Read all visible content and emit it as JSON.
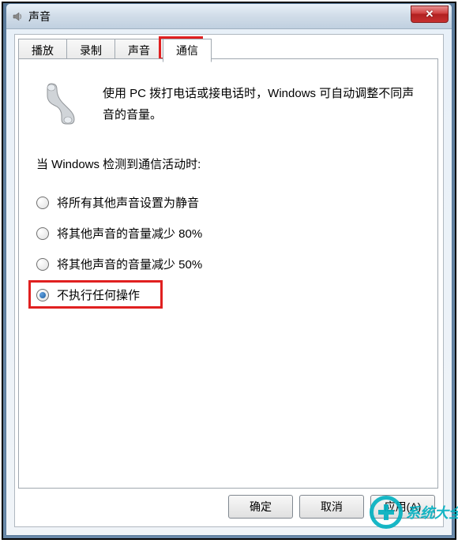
{
  "window": {
    "title": "声音"
  },
  "tabs": {
    "items": [
      {
        "label": "播放"
      },
      {
        "label": "录制"
      },
      {
        "label": "声音"
      },
      {
        "label": "通信"
      }
    ],
    "active_index": 3
  },
  "panel": {
    "intro": "使用 PC 拨打电话或接电话时，Windows 可自动调整不同声音的音量。",
    "section_label": "当 Windows 检测到通信活动时:",
    "options": [
      {
        "label": "将所有其他声音设置为静音",
        "checked": false
      },
      {
        "label": "将其他声音的音量减少 80%",
        "checked": false
      },
      {
        "label": "将其他声音的音量减少 50%",
        "checked": false
      },
      {
        "label": "不执行任何操作",
        "checked": true
      }
    ]
  },
  "buttons": {
    "ok": "确定",
    "cancel": "取消",
    "apply": "应用(A)"
  },
  "watermark": {
    "text": "系统大全"
  }
}
